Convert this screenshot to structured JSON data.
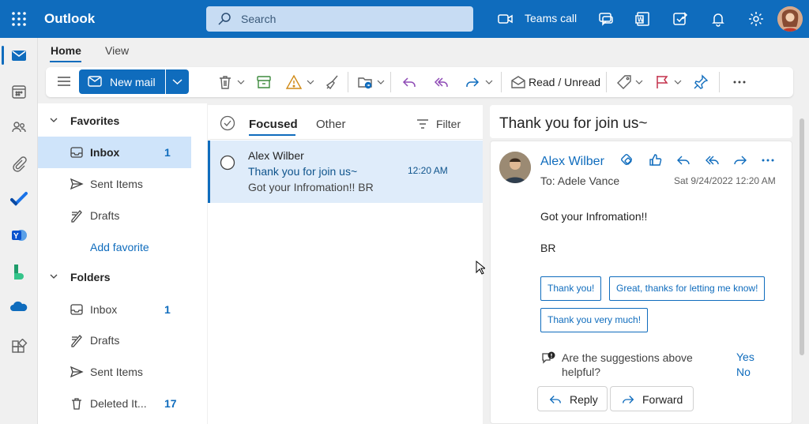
{
  "app": {
    "name": "Outlook"
  },
  "search": {
    "placeholder": "Search"
  },
  "topbar": {
    "teams_call_label": "Teams call"
  },
  "ribbon": {
    "tabs": [
      "Home",
      "View"
    ],
    "new_mail_label": "New mail",
    "read_unread_label": "Read / Unread"
  },
  "folders": {
    "favorites_header": "Favorites",
    "favorites": [
      {
        "label": "Inbox",
        "count": "1"
      },
      {
        "label": "Sent Items",
        "count": ""
      },
      {
        "label": "Drafts",
        "count": ""
      }
    ],
    "add_favorite_label": "Add favorite",
    "folders_header": "Folders",
    "items": [
      {
        "label": "Inbox",
        "count": "1"
      },
      {
        "label": "Drafts",
        "count": ""
      },
      {
        "label": "Sent Items",
        "count": ""
      },
      {
        "label": "Deleted It...",
        "count": "17"
      }
    ]
  },
  "message_list": {
    "tabs": [
      "Focused",
      "Other"
    ],
    "filter_label": "Filter",
    "messages": [
      {
        "sender": "Alex Wilber",
        "subject": "Thank you for join us~",
        "time": "12:20 AM",
        "preview": "Got your Infromation!! BR"
      }
    ]
  },
  "reading_pane": {
    "title": "Thank you for join us~",
    "sender": "Alex Wilber",
    "to": "To:  Adele Vance",
    "date": "Sat 9/24/2022 12:20 AM",
    "body": [
      "Got your Infromation!!",
      "BR"
    ],
    "suggestions": [
      "Thank you!",
      "Great, thanks for letting me know!",
      "Thank you very much!"
    ],
    "feedback_question": "Are the suggestions above helpful?",
    "feedback_yes": "Yes",
    "feedback_no": "No",
    "reply_label": "Reply",
    "forward_label": "Forward"
  },
  "colors": {
    "brand": "#0f6cbd",
    "selected_bg": "#cfe4fa"
  }
}
